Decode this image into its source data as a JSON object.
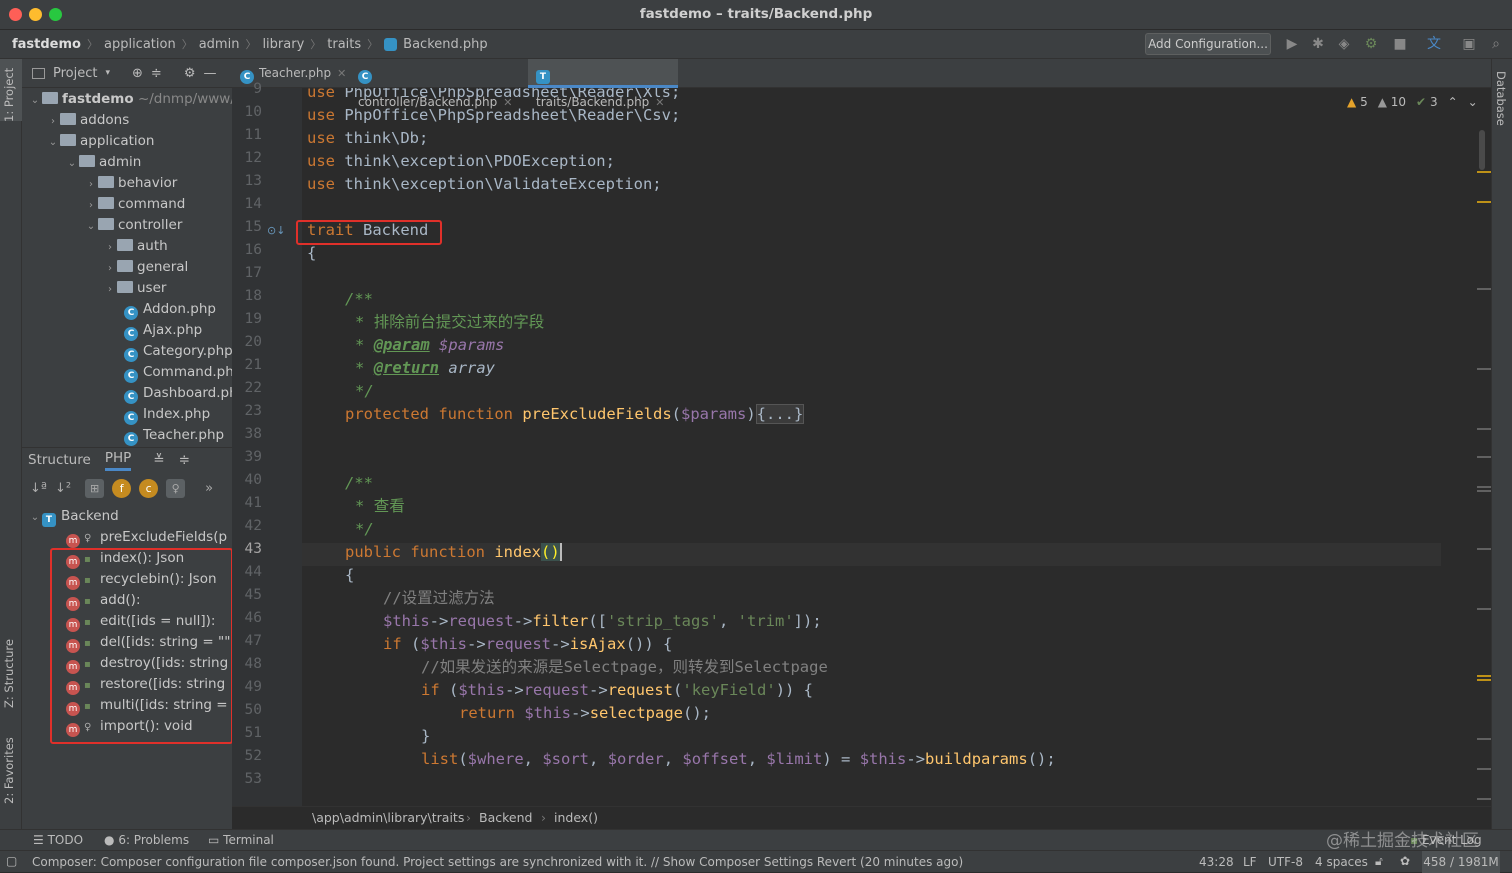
{
  "window": {
    "title": "fastdemo – traits/Backend.php"
  },
  "nav": {
    "crumbs": [
      "fastdemo",
      "application",
      "admin",
      "library",
      "traits",
      "Backend.php"
    ],
    "add_config": "Add Configuration..."
  },
  "left_strip": {
    "project": "1: Project",
    "structure": "Z: Structure",
    "favorites": "2: Favorites"
  },
  "right_strip": {
    "database": "Database"
  },
  "project": {
    "header": "Project",
    "root_name": "fastdemo",
    "root_path": "~/dnmp/www/",
    "items": [
      "addons",
      "application",
      "admin",
      "behavior",
      "command",
      "controller",
      "auth",
      "general",
      "user",
      "Addon.php",
      "Ajax.php",
      "Category.php",
      "Command.php",
      "Dashboard.php",
      "Index.php",
      "Teacher.php"
    ]
  },
  "structure": {
    "tabs": [
      "Structure",
      "PHP"
    ],
    "root": "Backend",
    "members": [
      "preExcludeFields(p",
      "index(): Json",
      "recyclebin(): Json",
      "add():",
      "edit([ids = null]):",
      "del([ids: string = \"\"",
      "destroy([ids: string",
      "restore([ids: string",
      "multi([ids: string = '",
      "import(): void"
    ]
  },
  "tabs": [
    {
      "label": "Teacher.php"
    },
    {
      "label": "controller/Backend.php"
    },
    {
      "label": "traits/Backend.php"
    }
  ],
  "inspections": {
    "warn": "5",
    "weak": "10",
    "ok": "3"
  },
  "line_numbers": [
    "9",
    "10",
    "11",
    "12",
    "13",
    "14",
    "15",
    "16",
    "17",
    "18",
    "19",
    "20",
    "21",
    "22",
    "23",
    "38",
    "39",
    "40",
    "41",
    "42",
    "43",
    "44",
    "45",
    "46",
    "47",
    "48",
    "49",
    "50",
    "51",
    "52",
    "53"
  ],
  "code_text": {
    "use": "use",
    "l9": "PhpOffice\\PhpSpreadsheet\\Reader\\Xls;",
    "l10": "PhpOffice\\PhpSpreadsheet\\Reader\\Csv;",
    "l11": "think\\Db;",
    "l12": "think\\exception\\PDOException;",
    "l13": "think\\exception\\ValidateException;",
    "trait": "trait",
    "trait_name": "Backend",
    "brace_open": "{",
    "doc_open": "/**",
    "doc_star": "*",
    "doc_close": "*/",
    "doc1": "排除前台提交过来的字段",
    "param_tag": "@param",
    "param_var": "$params",
    "return_tag": "@return",
    "return_type": "array",
    "protected": "protected",
    "function": "function",
    "fn1": "preExcludeFields",
    "fn1_param": "$params",
    "fold": "{...}",
    "doc2": "查看",
    "public": "public",
    "fn2": "index",
    "comment1": "//设置过滤方法",
    "this": "$this",
    "arrow": "->",
    "request": "request",
    "filter": "filter",
    "strip_tags": "'strip_tags'",
    "trim": "'trim'",
    "if": "if",
    "isAjax": "isAjax",
    "comment2": "//如果发送的来源是Selectpage，则转发到Selectpage",
    "request_fn": "request",
    "keyField": "'keyField'",
    "return": "return",
    "selectpage": "selectpage",
    "list": "list",
    "where": "$where",
    "sort": "$sort",
    "order": "$order",
    "offset": "$offset",
    "limit": "$limit",
    "buildparams": "buildparams",
    "brace_close": "}"
  },
  "breadcrumb": {
    "path": "\\app\\admin\\library\\traits",
    "cls": "Backend",
    "method": "index()"
  },
  "bottom": {
    "todo": "TODO",
    "problems": "6: Problems",
    "terminal": "Terminal",
    "event_log": "Event Log",
    "watermark": "@稀土掘金技术社区"
  },
  "status": {
    "message": "Composer: Composer configuration file composer.json found. Project settings are synchronized with it. // Show Composer Settings   Revert (20 minutes ago)",
    "position": "43:28",
    "line_sep": "LF",
    "encoding": "UTF-8",
    "indent": "4 spaces",
    "memory": "458 / 1981M"
  },
  "colors": {
    "accent": "#4a88c7",
    "highlight_box": "#e0302a",
    "keyword": "#cc7832",
    "function": "#ffc66d",
    "variable": "#9876aa",
    "string": "#6a8759"
  }
}
